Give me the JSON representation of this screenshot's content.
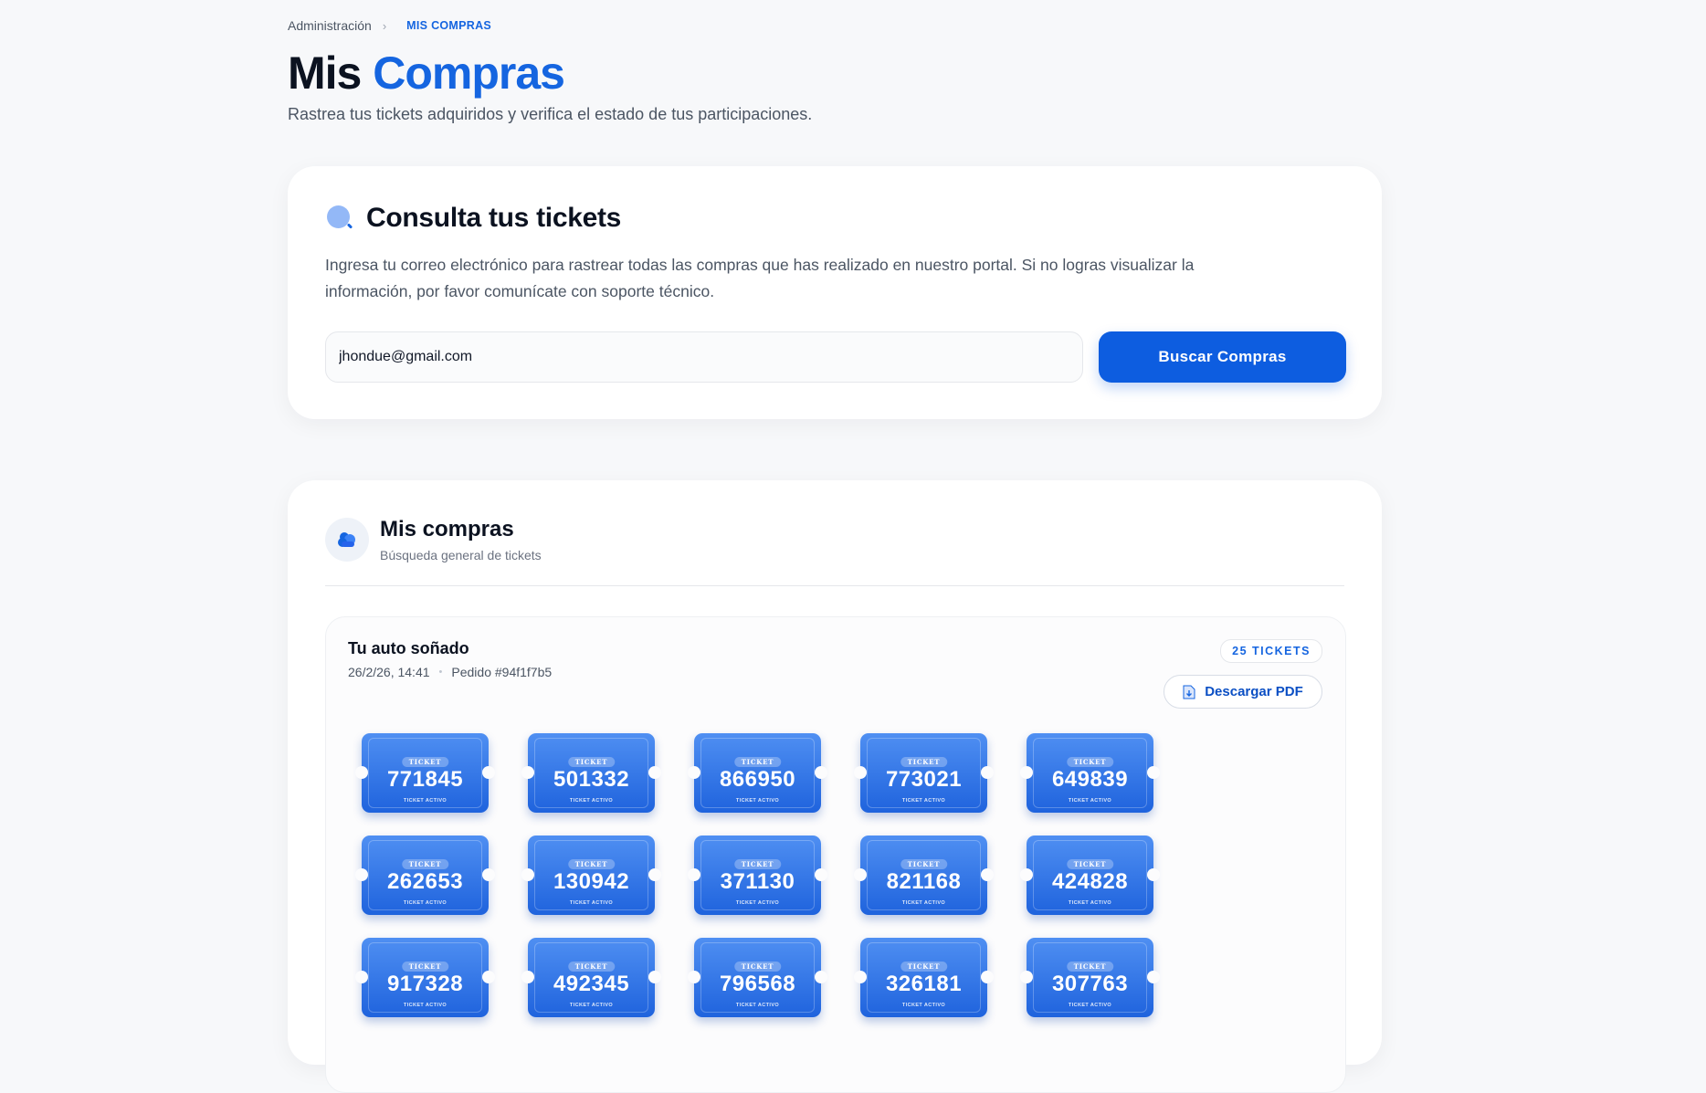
{
  "breadcrumb": {
    "home": "Administración",
    "current": "MIS COMPRAS"
  },
  "page": {
    "title_part1": "Mis",
    "title_part2": "Compras",
    "subtitle": "Rastrea tus tickets adquiridos y verifica el estado de tus participaciones."
  },
  "search": {
    "title": "Consulta tus tickets",
    "description": "Ingresa tu correo electrónico para rastrear todas las compras que has realizado en nuestro portal. Si no logras visualizar la información, por favor comunícate con soporte técnico.",
    "email_value": "jhondue@gmail.com",
    "button_label": "Buscar Compras"
  },
  "purchases": {
    "title": "Mis compras",
    "subtitle": "Búsqueda general de tickets",
    "order": {
      "name": "Tu auto soñado",
      "date": "26/2/26, 14:41",
      "order_id": "Pedido #94f1f7b5",
      "ticket_count_badge": "25 TICKETS",
      "download_label": "Descargar PDF",
      "ticket_label": "TICKET",
      "ticket_status": "TICKET ACTIVO",
      "tickets": [
        "771845",
        "501332",
        "866950",
        "773021",
        "649839",
        "262653",
        "130942",
        "371130",
        "821168",
        "424828",
        "917328",
        "492345",
        "796568",
        "326181",
        "307763"
      ]
    }
  },
  "colors": {
    "accent": "#1565e0",
    "primary_button": "#0d5de0",
    "background": "#f7f8fa"
  },
  "icons": {
    "search": "search-icon",
    "purchases": "cloud-icon",
    "download": "file-download-icon"
  }
}
